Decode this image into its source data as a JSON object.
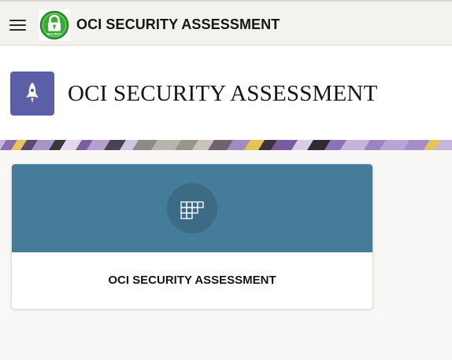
{
  "topbar": {
    "menu_icon": "hamburger-menu-icon",
    "logo_icon": "security-lock-logo-icon",
    "logo_text": "SECURITY",
    "title": "OCI SECURITY ASSESSMENT"
  },
  "header": {
    "icon": "rocket-icon",
    "title": "OCI SECURITY ASSESSMENT"
  },
  "cards": [
    {
      "icon": "grid-blocks-icon",
      "label": "OCI SECURITY ASSESSMENT"
    }
  ],
  "colors": {
    "topbar_bg": "#f4f2ef",
    "header_icon_bg": "#5b5fa8",
    "card_banner": "#457c99",
    "card_icon_circle": "#3b6b85",
    "logo_green": "#3aa935"
  }
}
